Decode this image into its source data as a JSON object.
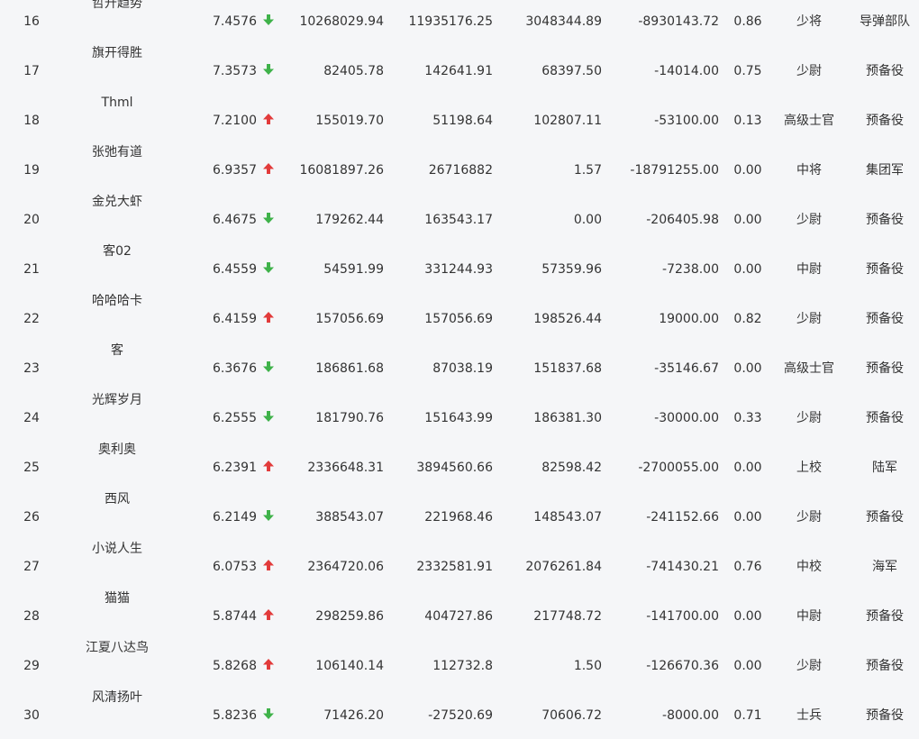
{
  "colors": {
    "up": "#e23b3b",
    "down": "#3fb24a",
    "text": "#333333",
    "background": "#f5f6f8"
  },
  "rows": [
    {
      "rank": "16",
      "name": "哲升趋势",
      "score": "7.4576",
      "trend": "down",
      "c1": "10268029.94",
      "c2": "11935176.25",
      "c3": "3048344.89",
      "c4": "-8930143.72",
      "ratio": "0.86",
      "rank_name": "少将",
      "unit": "导弹部队"
    },
    {
      "rank": "17",
      "name": "旗开得胜",
      "score": "7.3573",
      "trend": "down",
      "c1": "82405.78",
      "c2": "142641.91",
      "c3": "68397.50",
      "c4": "-14014.00",
      "ratio": "0.75",
      "rank_name": "少尉",
      "unit": "预备役"
    },
    {
      "rank": "18",
      "name": "Thml",
      "score": "7.2100",
      "trend": "up",
      "c1": "155019.70",
      "c2": "51198.64",
      "c3": "102807.11",
      "c4": "-53100.00",
      "ratio": "0.13",
      "rank_name": "高级士官",
      "unit": "预备役"
    },
    {
      "rank": "19",
      "name": "张弛有道",
      "score": "6.9357",
      "trend": "up",
      "c1": "16081897.26",
      "c2": "26716882",
      "c3": "1.57",
      "c4": "-18791255.00",
      "ratio": "0.00",
      "rank_name": "中将",
      "unit": "集团军"
    },
    {
      "rank": "20",
      "name": "金兑大虾",
      "score": "6.4675",
      "trend": "down",
      "c1": "179262.44",
      "c2": "163543.17",
      "c3": "0.00",
      "c4": "-206405.98",
      "ratio": "0.00",
      "rank_name": "少尉",
      "unit": "预备役"
    },
    {
      "rank": "21",
      "name": "客02",
      "score": "6.4559",
      "trend": "down",
      "c1": "54591.99",
      "c2": "331244.93",
      "c3": "57359.96",
      "c4": "-7238.00",
      "ratio": "0.00",
      "rank_name": "中尉",
      "unit": "预备役"
    },
    {
      "rank": "22",
      "name": "哈哈哈卡",
      "score": "6.4159",
      "trend": "up",
      "c1": "157056.69",
      "c2": "157056.69",
      "c3": "198526.44",
      "c4": "19000.00",
      "ratio": "0.82",
      "rank_name": "少尉",
      "unit": "预备役"
    },
    {
      "rank": "23",
      "name": "客",
      "score": "6.3676",
      "trend": "down",
      "c1": "186861.68",
      "c2": "87038.19",
      "c3": "151837.68",
      "c4": "-35146.67",
      "ratio": "0.00",
      "rank_name": "高级士官",
      "unit": "预备役"
    },
    {
      "rank": "24",
      "name": "光辉岁月",
      "score": "6.2555",
      "trend": "down",
      "c1": "181790.76",
      "c2": "151643.99",
      "c3": "186381.30",
      "c4": "-30000.00",
      "ratio": "0.33",
      "rank_name": "少尉",
      "unit": "预备役"
    },
    {
      "rank": "25",
      "name": "奥利奥",
      "score": "6.2391",
      "trend": "up",
      "c1": "2336648.31",
      "c2": "3894560.66",
      "c3": "82598.42",
      "c4": "-2700055.00",
      "ratio": "0.00",
      "rank_name": "上校",
      "unit": "陆军"
    },
    {
      "rank": "26",
      "name": "西风",
      "score": "6.2149",
      "trend": "down",
      "c1": "388543.07",
      "c2": "221968.46",
      "c3": "148543.07",
      "c4": "-241152.66",
      "ratio": "0.00",
      "rank_name": "少尉",
      "unit": "预备役"
    },
    {
      "rank": "27",
      "name": "小说人生",
      "score": "6.0753",
      "trend": "up",
      "c1": "2364720.06",
      "c2": "2332581.91",
      "c3": "2076261.84",
      "c4": "-741430.21",
      "ratio": "0.76",
      "rank_name": "中校",
      "unit": "海军"
    },
    {
      "rank": "28",
      "name": "猫猫",
      "score": "5.8744",
      "trend": "up",
      "c1": "298259.86",
      "c2": "404727.86",
      "c3": "217748.72",
      "c4": "-141700.00",
      "ratio": "0.00",
      "rank_name": "中尉",
      "unit": "预备役"
    },
    {
      "rank": "29",
      "name": "江夏八达鸟",
      "score": "5.8268",
      "trend": "up",
      "c1": "106140.14",
      "c2": "112732.8",
      "c3": "1.50",
      "c4": "-126670.36",
      "ratio": "0.00",
      "rank_name": "少尉",
      "unit": "预备役"
    },
    {
      "rank": "30",
      "name": "风清扬叶",
      "score": "5.8236",
      "trend": "down",
      "c1": "71426.20",
      "c2": "-27520.69",
      "c3": "70606.72",
      "c4": "-8000.00",
      "ratio": "0.71",
      "rank_name": "士兵",
      "unit": "预备役"
    }
  ]
}
